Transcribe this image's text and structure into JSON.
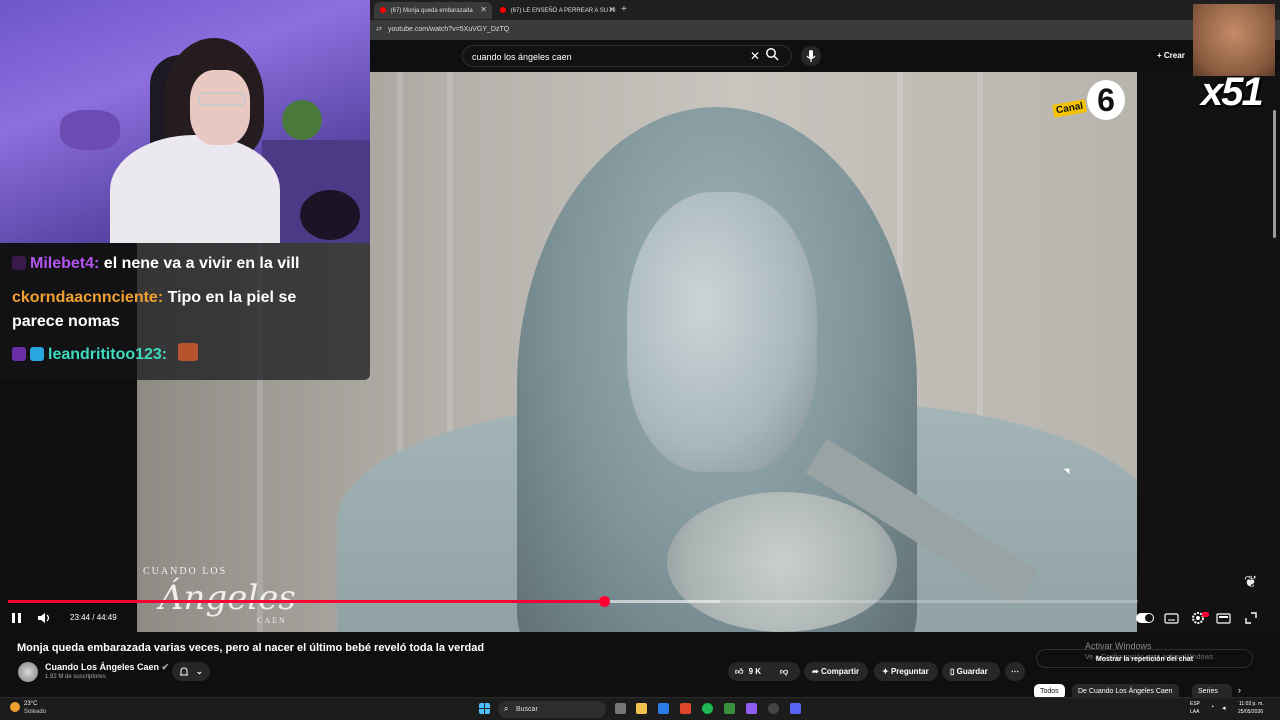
{
  "browser": {
    "tabs": [
      {
        "label": "(67) Monja queda embarazada"
      },
      {
        "label": "(67) LE ENSEÑÓ A PERREAR A SU HI"
      }
    ],
    "url": "youtube.com/watch?v=5XuVGY_DzTQ"
  },
  "youtube": {
    "search_value": "cuando los ángeles caen",
    "create_label": "Crear"
  },
  "video": {
    "channel_logo_text": "Canal",
    "channel_logo_number": "6",
    "watermark_line1": "CUANDO LOS",
    "watermark_line2": "Ángeles",
    "watermark_line3": "CAEN",
    "time": "23:44 / 44:49",
    "progress_fraction": 0.527
  },
  "chat_overlay": {
    "messages": [
      {
        "user": "Milebet4:",
        "text": " el nene va a vivir en la vill"
      },
      {
        "user": "ckorndaacnnciente:",
        "text": " Tipo en la piel se"
      },
      {
        "user": "",
        "text": "parece nomas"
      },
      {
        "user": "leandrititoo123:",
        "text": ""
      }
    ]
  },
  "sticker": {
    "text": "x51"
  },
  "below_video": {
    "title": "Monja queda embarazada varias veces, pero al nacer el último bebé reveló toda la verdad",
    "channel_name": "Cuando Los Ángeles Caen",
    "subscribers": "1.92 M de suscriptores",
    "like_count": "9 K",
    "share_label": "Compartir",
    "ask_label": "Preguntar",
    "save_label": "Guardar",
    "activate_windows": "Activar Windows",
    "activate_windows_sub": "Ve a Configuración para activar Windows.",
    "chat_replay_label": "Mostrar la repetición del chat",
    "chips": [
      "Todos",
      "De Cuando Los Ángeles Caen",
      "Series"
    ]
  },
  "taskbar": {
    "temperature": "23°C",
    "weather": "Soleado",
    "search_label": "Buscar",
    "lang1": "ESP",
    "lang2": "LAA",
    "time": "11:03 p. m.",
    "date": "25/05/2026"
  },
  "colors": {
    "accent_red": "#ff0033",
    "user1": "#b455f0",
    "user2": "#f0a030",
    "user3": "#3ddbc0"
  }
}
